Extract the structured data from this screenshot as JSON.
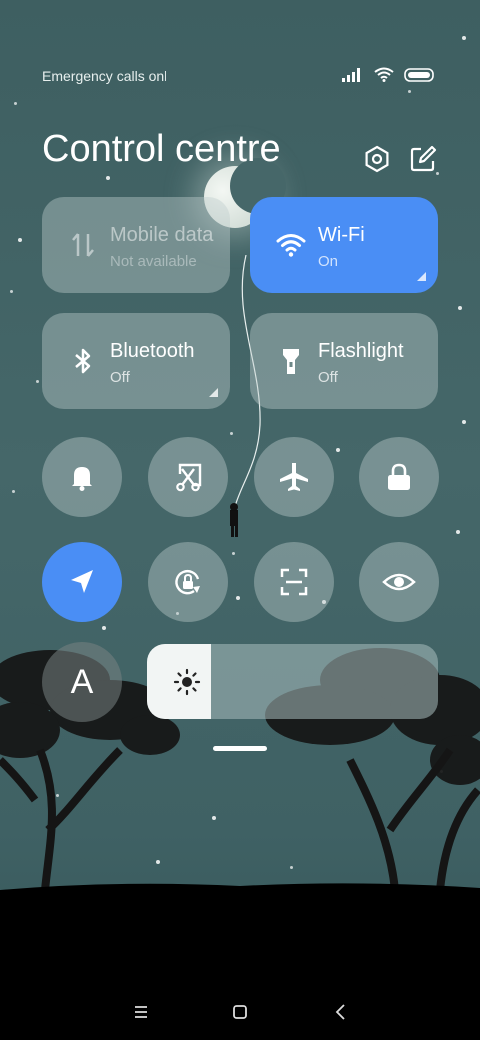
{
  "status_bar": {
    "carrier_text": "Emergency calls only",
    "icons": [
      "signal-icon",
      "wifi-icon",
      "battery-icon"
    ]
  },
  "header": {
    "title": "Control centre",
    "icons": [
      "settings-icon",
      "edit-icon"
    ]
  },
  "tiles": [
    {
      "label": "Mobile data",
      "sub": "Not available",
      "icon": "mobile-data-icon",
      "state": "unavailable"
    },
    {
      "label": "Wi-Fi",
      "sub": "On",
      "icon": "wifi-icon",
      "state": "on"
    },
    {
      "label": "Bluetooth",
      "sub": "Off",
      "icon": "bluetooth-icon",
      "state": "off"
    },
    {
      "label": "Flashlight",
      "sub": "Off",
      "icon": "flashlight-icon",
      "state": "off"
    }
  ],
  "toggles_row1": [
    {
      "icon": "bell-icon",
      "state": "off"
    },
    {
      "icon": "screenshot-icon",
      "state": "off"
    },
    {
      "icon": "airplane-icon",
      "state": "off"
    },
    {
      "icon": "lock-icon",
      "state": "off"
    }
  ],
  "toggles_row2": [
    {
      "icon": "location-icon",
      "state": "on"
    },
    {
      "icon": "auto-rotate-icon",
      "state": "off"
    },
    {
      "icon": "scan-icon",
      "state": "off"
    },
    {
      "icon": "eye-icon",
      "state": "off"
    }
  ],
  "font_button": {
    "letter": "A"
  },
  "brightness": {
    "level": 0.22,
    "icon": "brightness-icon"
  },
  "navigation": {
    "icons": [
      "menu-icon",
      "home-icon",
      "back-icon"
    ]
  },
  "colors": {
    "accent": "#4a8ef5",
    "tile_bg": "rgba(190,205,205,0.42)",
    "background": "#456769"
  }
}
